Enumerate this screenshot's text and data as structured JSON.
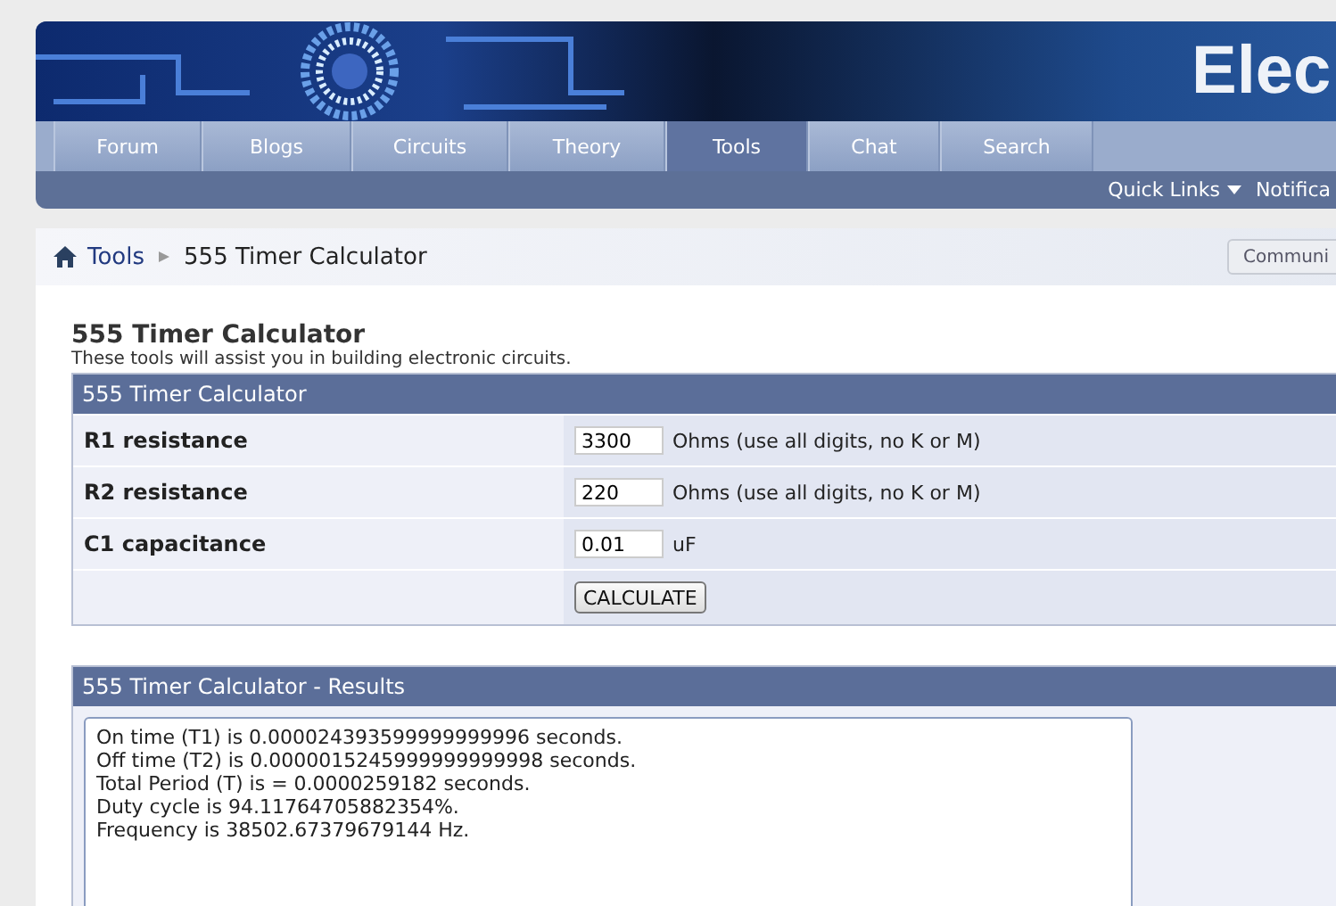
{
  "banner": {
    "site_title": "Elec"
  },
  "nav": {
    "tabs": [
      {
        "label": "Forum",
        "selected": false
      },
      {
        "label": "Blogs",
        "selected": false
      },
      {
        "label": "Circuits",
        "selected": false
      },
      {
        "label": "Theory",
        "selected": false
      },
      {
        "label": "Tools",
        "selected": true
      },
      {
        "label": "Chat",
        "selected": false
      },
      {
        "label": "Search",
        "selected": false
      }
    ],
    "sub_links": [
      "Quick Links",
      "Notifica"
    ]
  },
  "breadcrumb": {
    "items": [
      "Tools",
      "555 Timer Calculator"
    ],
    "button": "Communi"
  },
  "page": {
    "title": "555 Timer Calculator",
    "subtitle": "These tools will assist you in building electronic circuits."
  },
  "form": {
    "heading": "555 Timer Calculator",
    "rows": [
      {
        "label": "R1 resistance",
        "value": "3300",
        "unit": "Ohms (use all digits, no K or M)"
      },
      {
        "label": "R2 resistance",
        "value": "220",
        "unit": "Ohms (use all digits, no K or M)"
      },
      {
        "label": "C1 capacitance",
        "value": "0.01",
        "unit": "uF"
      }
    ],
    "button": "CALCULATE"
  },
  "results": {
    "heading": "555 Timer Calculator - Results",
    "lines": [
      "On time (T1) is 0.000024393599999999996 seconds.",
      "Off time (T2) is 0.0000015245999999999998 seconds.",
      "Total Period (T) is = 0.0000259182 seconds.",
      "Duty cycle is 94.11764705882354%.",
      "Frequency is 38502.67379679144 Hz."
    ]
  }
}
